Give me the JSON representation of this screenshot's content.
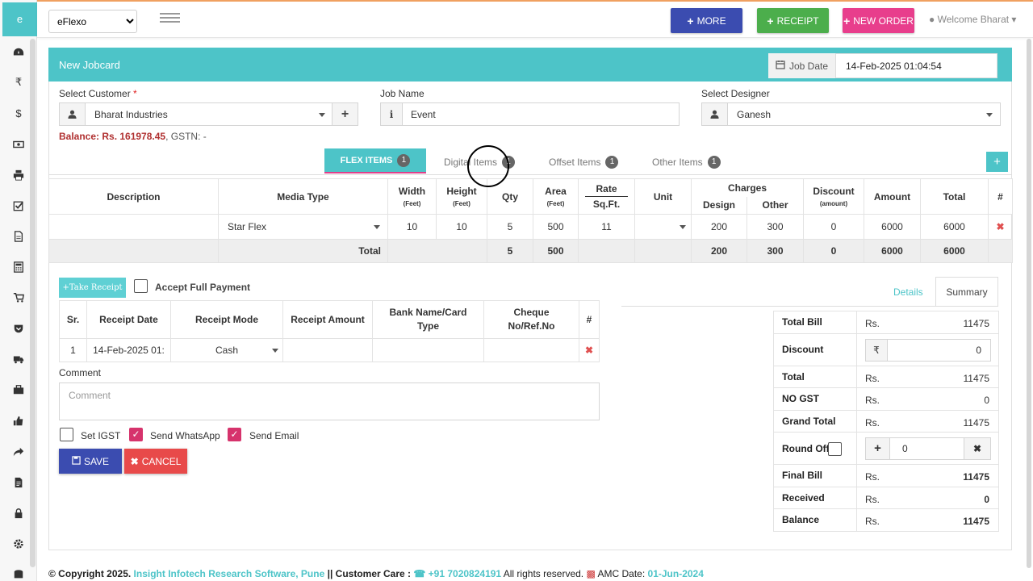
{
  "brand": {
    "logo": "e",
    "accent": "#4dc4c8"
  },
  "topbar": {
    "company": "eFlexo",
    "more": "MORE",
    "receipt": "RECEIPT",
    "new_order": "NEW ORDER",
    "welcome": "Welcome Bharat"
  },
  "sidebar": {
    "icons": [
      "dashboard-icon",
      "rupee-icon",
      "dollar-icon",
      "money-icon",
      "print-icon",
      "check-square-icon",
      "file-icon",
      "calculator-icon",
      "cart-icon",
      "shield-icon",
      "truck-icon",
      "briefcase-icon",
      "thumbs-up-icon",
      "share-icon",
      "document-icon",
      "lock-icon",
      "gear-icon",
      "database-icon"
    ]
  },
  "panel": {
    "title": "New Jobcard",
    "job_date_label": "Job Date",
    "job_date": "14-Feb-2025 01:04:54"
  },
  "form": {
    "customer_label": "Select Customer",
    "customer_required": "*",
    "customer": "Bharat Industries",
    "job_name_label": "Job Name",
    "job_name": "Event",
    "designer_label": "Select Designer",
    "designer": "Ganesh",
    "balance_label": "Balance: Rs. 161978.45",
    "gstn": ", GSTN: -"
  },
  "tabs": [
    {
      "label": "FLEX ITEMS",
      "count": "1"
    },
    {
      "label": "Digital Items",
      "count": "1"
    },
    {
      "label": "Offset Items",
      "count": "1"
    },
    {
      "label": "Other Items",
      "count": "1"
    }
  ],
  "items_table": {
    "headers": {
      "description": "Description",
      "media_type": "Media Type",
      "width": "Width",
      "width_unit": "(Feet)",
      "height": "Height",
      "height_unit": "(Feet)",
      "qty": "Qty",
      "area": "Area",
      "area_unit": "(Feet)",
      "rate": "Rate",
      "rate_unit": "Sq.Ft.",
      "unit": "Unit",
      "charges": "Charges",
      "design": "Design",
      "other": "Other",
      "discount": "Discount",
      "discount_unit": "(amount)",
      "amount": "Amount",
      "total": "Total",
      "hash": "#"
    },
    "row": {
      "description": "",
      "media_type": "Star Flex",
      "width": "10",
      "height": "10",
      "qty": "5",
      "area": "500",
      "rate": "11",
      "unit": "",
      "design": "200",
      "other": "300",
      "discount": "0",
      "amount": "6000",
      "total": "6000"
    },
    "totals": {
      "label": "Total",
      "qty": "5",
      "area": "500",
      "design": "200",
      "other": "300",
      "discount": "0",
      "amount": "6000",
      "total": "6000"
    }
  },
  "receipts": {
    "take_receipt": "Take Receipt",
    "accept_full_payment": "Accept Full Payment",
    "headers": {
      "sr": "Sr.",
      "date": "Receipt Date",
      "mode": "Receipt Mode",
      "amount": "Receipt Amount",
      "bank": "Bank Name/Card Type",
      "cheque": "Cheque No/Ref.No",
      "hash": "#"
    },
    "row": {
      "sr": "1",
      "date": "14-Feb-2025 01:",
      "mode": "Cash",
      "amount": "",
      "bank": "",
      "cheque": ""
    }
  },
  "comment": {
    "label": "Comment",
    "placeholder": "Comment"
  },
  "options": {
    "set_igst": "Set IGST",
    "send_whatsapp": "Send WhatsApp",
    "send_email": "Send Email"
  },
  "actions": {
    "save": "SAVE",
    "cancel": "CANCEL"
  },
  "summary": {
    "tab_details": "Details",
    "tab_summary": "Summary",
    "currency": "Rs.",
    "rows": {
      "total_bill": {
        "label": "Total Bill",
        "value": "11475"
      },
      "discount": {
        "label": "Discount",
        "value": "0",
        "symbol": "₹"
      },
      "total": {
        "label": "Total",
        "value": "11475"
      },
      "no_gst": {
        "label": "NO GST",
        "value": "0"
      },
      "grand_total": {
        "label": "Grand Total",
        "value": "11475"
      },
      "round_off": {
        "label": "Round Off",
        "value": "0"
      },
      "final_bill": {
        "label": "Final Bill",
        "value": "11475"
      },
      "received": {
        "label": "Received",
        "value": "0"
      },
      "balance": {
        "label": "Balance",
        "value": "11475"
      }
    }
  },
  "footer": {
    "copyright": "© Copyright 2025.",
    "company": "Insight Infotech Research Software, Pune",
    "care_label": "|| Customer Care :",
    "phone": "+91 7020824191",
    "rights": "All rights reserved.",
    "amc_label": "AMC Date:",
    "amc_date": "01-Jun-2024"
  }
}
